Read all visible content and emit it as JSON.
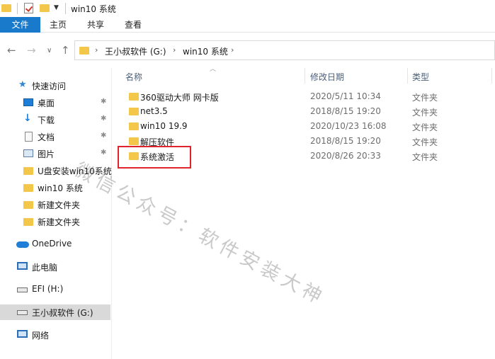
{
  "window": {
    "title": "win10 系统"
  },
  "ribbon": {
    "tabs": [
      "文件",
      "主页",
      "共享",
      "查看"
    ]
  },
  "address": {
    "crumbs": [
      "王小叔软件 (G:)",
      "win10 系统"
    ]
  },
  "sidebar": {
    "items": [
      {
        "label": "快速访问",
        "icon": "star-icon"
      },
      {
        "label": "桌面",
        "icon": "desktop-icon",
        "pinned": true
      },
      {
        "label": "下载",
        "icon": "download-icon",
        "pinned": true
      },
      {
        "label": "文档",
        "icon": "document-icon",
        "pinned": true
      },
      {
        "label": "图片",
        "icon": "picture-icon",
        "pinned": true
      },
      {
        "label": "U盘安装win10系统",
        "icon": "folder-icon"
      },
      {
        "label": "win10 系统",
        "icon": "folder-icon"
      },
      {
        "label": "新建文件夹",
        "icon": "folder-icon"
      },
      {
        "label": "新建文件夹",
        "icon": "folder-icon"
      },
      {
        "label": "OneDrive",
        "icon": "cloud-icon"
      },
      {
        "label": "此电脑",
        "icon": "computer-icon"
      },
      {
        "label": "EFI (H:)",
        "icon": "drive-icon"
      },
      {
        "label": "王小叔软件 (G:)",
        "icon": "drive-icon",
        "selected": true
      },
      {
        "label": "网络",
        "icon": "network-icon"
      }
    ]
  },
  "columns": {
    "name": "名称",
    "date": "修改日期",
    "type": "类型"
  },
  "files": [
    {
      "name": "360驱动大师 网卡版",
      "date": "2020/5/11 10:34",
      "type": "文件夹"
    },
    {
      "name": "net3.5",
      "date": "2018/8/15 19:20",
      "type": "文件夹"
    },
    {
      "name": "win10 19.9",
      "date": "2020/10/23 16:08",
      "type": "文件夹"
    },
    {
      "name": "解压软件",
      "date": "2018/8/15 19:20",
      "type": "文件夹"
    },
    {
      "name": "系统激活",
      "date": "2020/8/26 20:33",
      "type": "文件夹"
    }
  ],
  "watermark": "微信公众号：软件安装大神",
  "colors": {
    "accent": "#1979ca",
    "folder": "#f3c84a",
    "highlight": "#e0242c"
  }
}
